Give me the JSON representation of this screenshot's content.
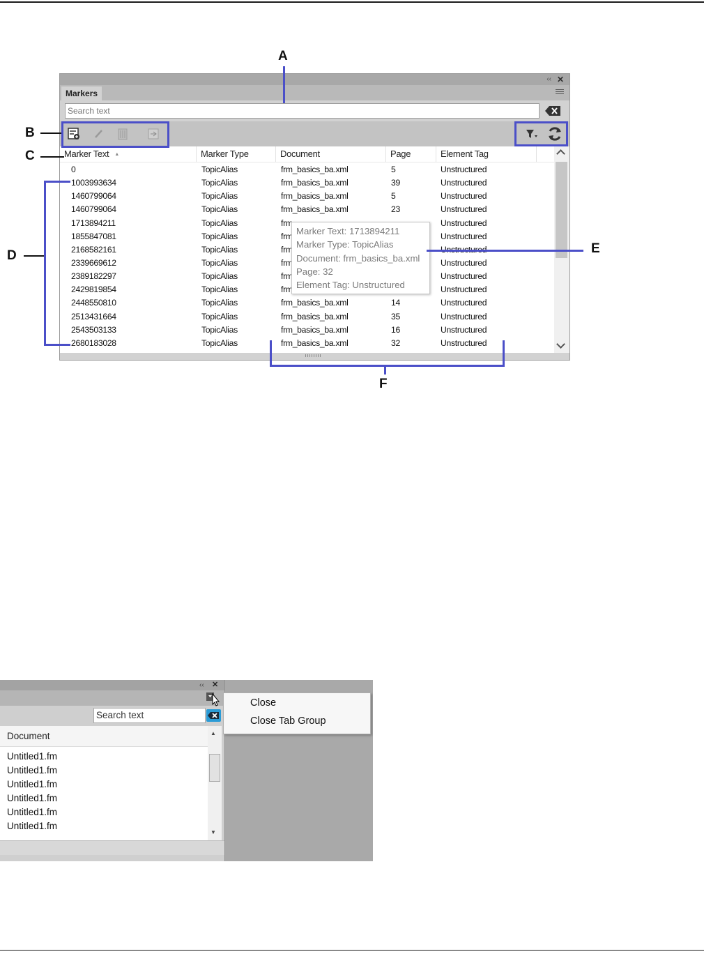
{
  "callouts": {
    "A": "A",
    "B": "B",
    "C": "C",
    "D": "D",
    "E": "E",
    "F": "F"
  },
  "panel": {
    "tab_label": "Markers",
    "search_placeholder": "Search text",
    "columns": [
      "Marker Text",
      "Marker Type",
      "Document",
      "Page",
      "Element Tag"
    ],
    "rows": [
      [
        "0",
        "TopicAlias",
        "frm_basics_ba.xml",
        "5",
        "Unstructured"
      ],
      [
        "1003993634",
        "TopicAlias",
        "frm_basics_ba.xml",
        "39",
        "Unstructured"
      ],
      [
        "1460799064",
        "TopicAlias",
        "frm_basics_ba.xml",
        "5",
        "Unstructured"
      ],
      [
        "1460799064",
        "TopicAlias",
        "frm_basics_ba.xml",
        "23",
        "Unstructured"
      ],
      [
        "1713894211",
        "TopicAlias",
        "frm",
        "",
        "Unstructured"
      ],
      [
        "1855847081",
        "TopicAlias",
        "frm",
        "",
        "Unstructured"
      ],
      [
        "2168582161",
        "TopicAlias",
        "frm",
        "",
        "Unstructured"
      ],
      [
        "2339669612",
        "TopicAlias",
        "frm",
        "",
        "Unstructured"
      ],
      [
        "2389182297",
        "TopicAlias",
        "frm",
        "",
        "Unstructured"
      ],
      [
        "2429819854",
        "TopicAlias",
        "frm",
        "",
        "Unstructured"
      ],
      [
        "2448550810",
        "TopicAlias",
        "frm_basics_ba.xml",
        "14",
        "Unstructured"
      ],
      [
        "2513431664",
        "TopicAlias",
        "frm_basics_ba.xml",
        "35",
        "Unstructured"
      ],
      [
        "2543503133",
        "TopicAlias",
        "frm_basics_ba.xml",
        "16",
        "Unstructured"
      ],
      [
        "2680183028",
        "TopicAlias",
        "frm_basics_ba.xml",
        "32",
        "Unstructured"
      ]
    ],
    "tooltip": [
      "Marker Text: 1713894211",
      "Marker Type: TopicAlias",
      "Document: frm_basics_ba.xml",
      "Page: 32",
      "Element Tag: Unstructured"
    ],
    "icons": [
      "new-marker-icon",
      "edit-marker-icon",
      "delete-marker-icon",
      "insert-marker-icon",
      "filter-icon",
      "refresh-icon",
      "clear-search-icon"
    ]
  },
  "shot2": {
    "search_value": "Search text",
    "column": "Document",
    "rows": [
      "Untitled1.fm",
      "Untitled1.fm",
      "Untitled1.fm",
      "Untitled1.fm",
      "Untitled1.fm",
      "Untitled1.fm"
    ],
    "menu": [
      "Close",
      "Close Tab Group"
    ]
  }
}
